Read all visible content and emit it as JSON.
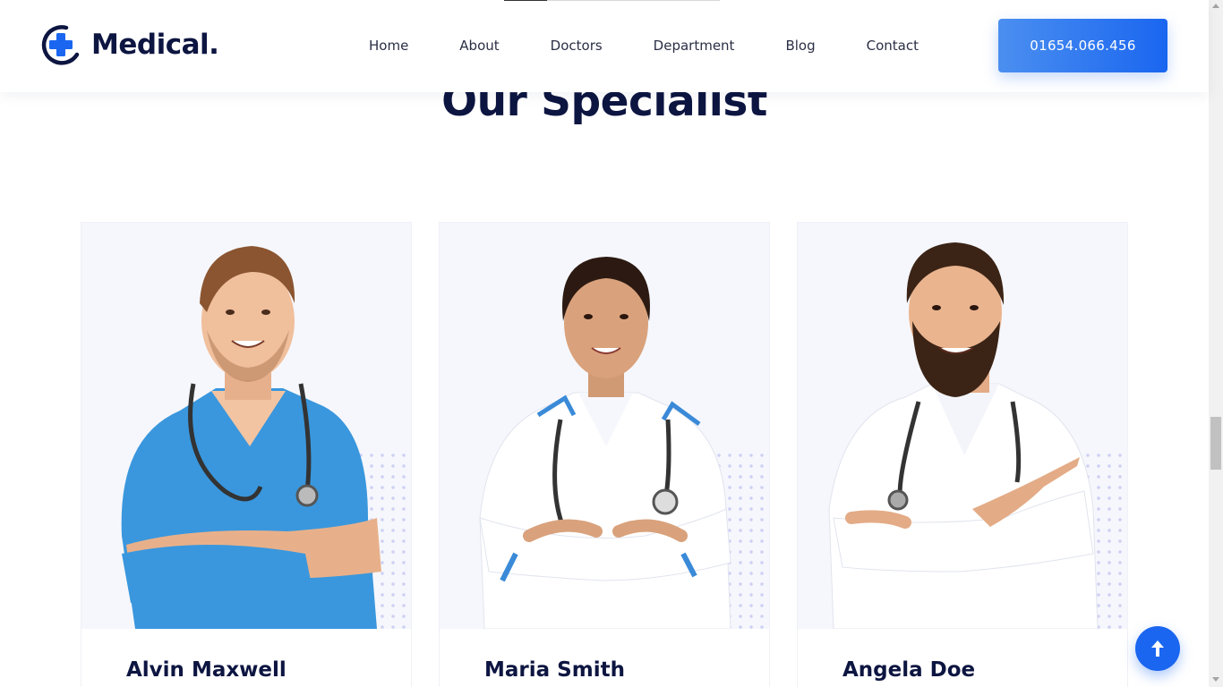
{
  "brand": {
    "name": "Medical",
    "dot": ".",
    "accent": "#1a66f0",
    "dark": "#0d1541"
  },
  "nav": {
    "items": [
      "Home",
      "About",
      "Doctors",
      "Department",
      "Blog",
      "Contact"
    ],
    "phone": "01654.066.456"
  },
  "section": {
    "title": "Our Specialist"
  },
  "doctors": [
    {
      "name": "Alvin Maxwell",
      "scrub_color": "#3a97dd"
    },
    {
      "name": "Maria Smith",
      "scrub_color": "#ffffff"
    },
    {
      "name": "Angela Doe",
      "scrub_color": "#ffffff"
    }
  ],
  "icons": {
    "logo": "medical-cross-icon",
    "back_to_top": "arrow-up-icon"
  }
}
